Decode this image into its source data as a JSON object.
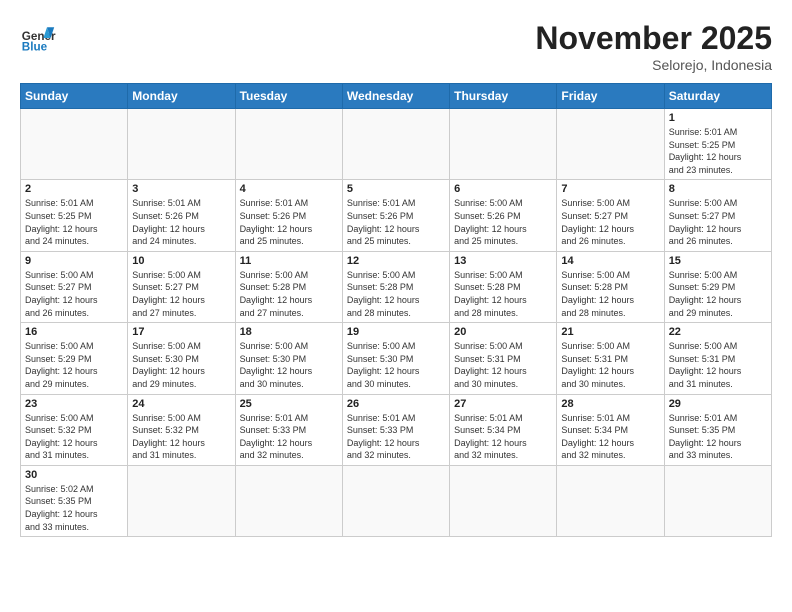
{
  "header": {
    "logo_general": "General",
    "logo_blue": "Blue",
    "month_title": "November 2025",
    "subtitle": "Selorejo, Indonesia"
  },
  "weekdays": [
    "Sunday",
    "Monday",
    "Tuesday",
    "Wednesday",
    "Thursday",
    "Friday",
    "Saturday"
  ],
  "weeks": [
    [
      {
        "day": "",
        "info": ""
      },
      {
        "day": "",
        "info": ""
      },
      {
        "day": "",
        "info": ""
      },
      {
        "day": "",
        "info": ""
      },
      {
        "day": "",
        "info": ""
      },
      {
        "day": "",
        "info": ""
      },
      {
        "day": "1",
        "info": "Sunrise: 5:01 AM\nSunset: 5:25 PM\nDaylight: 12 hours\nand 23 minutes."
      }
    ],
    [
      {
        "day": "2",
        "info": "Sunrise: 5:01 AM\nSunset: 5:25 PM\nDaylight: 12 hours\nand 24 minutes."
      },
      {
        "day": "3",
        "info": "Sunrise: 5:01 AM\nSunset: 5:26 PM\nDaylight: 12 hours\nand 24 minutes."
      },
      {
        "day": "4",
        "info": "Sunrise: 5:01 AM\nSunset: 5:26 PM\nDaylight: 12 hours\nand 25 minutes."
      },
      {
        "day": "5",
        "info": "Sunrise: 5:01 AM\nSunset: 5:26 PM\nDaylight: 12 hours\nand 25 minutes."
      },
      {
        "day": "6",
        "info": "Sunrise: 5:00 AM\nSunset: 5:26 PM\nDaylight: 12 hours\nand 25 minutes."
      },
      {
        "day": "7",
        "info": "Sunrise: 5:00 AM\nSunset: 5:27 PM\nDaylight: 12 hours\nand 26 minutes."
      },
      {
        "day": "8",
        "info": "Sunrise: 5:00 AM\nSunset: 5:27 PM\nDaylight: 12 hours\nand 26 minutes."
      }
    ],
    [
      {
        "day": "9",
        "info": "Sunrise: 5:00 AM\nSunset: 5:27 PM\nDaylight: 12 hours\nand 26 minutes."
      },
      {
        "day": "10",
        "info": "Sunrise: 5:00 AM\nSunset: 5:27 PM\nDaylight: 12 hours\nand 27 minutes."
      },
      {
        "day": "11",
        "info": "Sunrise: 5:00 AM\nSunset: 5:28 PM\nDaylight: 12 hours\nand 27 minutes."
      },
      {
        "day": "12",
        "info": "Sunrise: 5:00 AM\nSunset: 5:28 PM\nDaylight: 12 hours\nand 28 minutes."
      },
      {
        "day": "13",
        "info": "Sunrise: 5:00 AM\nSunset: 5:28 PM\nDaylight: 12 hours\nand 28 minutes."
      },
      {
        "day": "14",
        "info": "Sunrise: 5:00 AM\nSunset: 5:28 PM\nDaylight: 12 hours\nand 28 minutes."
      },
      {
        "day": "15",
        "info": "Sunrise: 5:00 AM\nSunset: 5:29 PM\nDaylight: 12 hours\nand 29 minutes."
      }
    ],
    [
      {
        "day": "16",
        "info": "Sunrise: 5:00 AM\nSunset: 5:29 PM\nDaylight: 12 hours\nand 29 minutes."
      },
      {
        "day": "17",
        "info": "Sunrise: 5:00 AM\nSunset: 5:30 PM\nDaylight: 12 hours\nand 29 minutes."
      },
      {
        "day": "18",
        "info": "Sunrise: 5:00 AM\nSunset: 5:30 PM\nDaylight: 12 hours\nand 30 minutes."
      },
      {
        "day": "19",
        "info": "Sunrise: 5:00 AM\nSunset: 5:30 PM\nDaylight: 12 hours\nand 30 minutes."
      },
      {
        "day": "20",
        "info": "Sunrise: 5:00 AM\nSunset: 5:31 PM\nDaylight: 12 hours\nand 30 minutes."
      },
      {
        "day": "21",
        "info": "Sunrise: 5:00 AM\nSunset: 5:31 PM\nDaylight: 12 hours\nand 30 minutes."
      },
      {
        "day": "22",
        "info": "Sunrise: 5:00 AM\nSunset: 5:31 PM\nDaylight: 12 hours\nand 31 minutes."
      }
    ],
    [
      {
        "day": "23",
        "info": "Sunrise: 5:00 AM\nSunset: 5:32 PM\nDaylight: 12 hours\nand 31 minutes."
      },
      {
        "day": "24",
        "info": "Sunrise: 5:00 AM\nSunset: 5:32 PM\nDaylight: 12 hours\nand 31 minutes."
      },
      {
        "day": "25",
        "info": "Sunrise: 5:01 AM\nSunset: 5:33 PM\nDaylight: 12 hours\nand 32 minutes."
      },
      {
        "day": "26",
        "info": "Sunrise: 5:01 AM\nSunset: 5:33 PM\nDaylight: 12 hours\nand 32 minutes."
      },
      {
        "day": "27",
        "info": "Sunrise: 5:01 AM\nSunset: 5:34 PM\nDaylight: 12 hours\nand 32 minutes."
      },
      {
        "day": "28",
        "info": "Sunrise: 5:01 AM\nSunset: 5:34 PM\nDaylight: 12 hours\nand 32 minutes."
      },
      {
        "day": "29",
        "info": "Sunrise: 5:01 AM\nSunset: 5:35 PM\nDaylight: 12 hours\nand 33 minutes."
      }
    ],
    [
      {
        "day": "30",
        "info": "Sunrise: 5:02 AM\nSunset: 5:35 PM\nDaylight: 12 hours\nand 33 minutes."
      },
      {
        "day": "",
        "info": ""
      },
      {
        "day": "",
        "info": ""
      },
      {
        "day": "",
        "info": ""
      },
      {
        "day": "",
        "info": ""
      },
      {
        "day": "",
        "info": ""
      },
      {
        "day": "",
        "info": ""
      }
    ]
  ]
}
